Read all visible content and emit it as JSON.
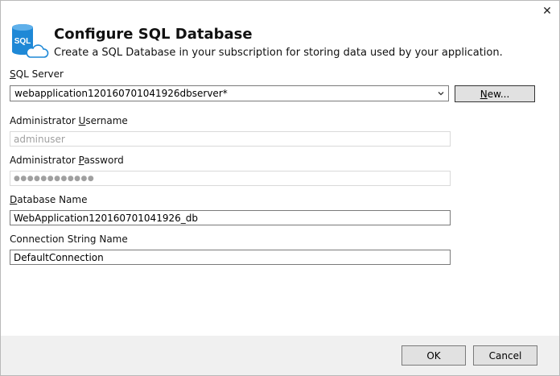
{
  "dialog": {
    "close_glyph": "✕",
    "title": "Configure SQL Database",
    "subtitle": "Create a SQL Database in your subscription for storing data used by your application.",
    "icon": {
      "name": "sql-database-icon",
      "text": "SQL",
      "color": "#1e88d6"
    }
  },
  "form": {
    "sql_server": {
      "label_prefix": "",
      "label_accel": "S",
      "label_rest": "QL Server",
      "value": "webapplication120160701041926dbserver*",
      "new_button_accel": "N",
      "new_button_rest": "ew..."
    },
    "admin_username": {
      "label_prefix": "Administrator ",
      "label_accel": "U",
      "label_rest": "sername",
      "value": "adminuser"
    },
    "admin_password": {
      "label_prefix": "Administrator ",
      "label_accel": "P",
      "label_rest": "assword",
      "value": "●●●●●●●●●●●●"
    },
    "database_name": {
      "label_prefix": "",
      "label_accel": "D",
      "label_rest": "atabase Name",
      "value": "WebApplication120160701041926_db"
    },
    "connection_string": {
      "label": "Connection String Name",
      "value": "DefaultConnection"
    }
  },
  "footer": {
    "ok_label": "OK",
    "cancel_label": "Cancel"
  }
}
